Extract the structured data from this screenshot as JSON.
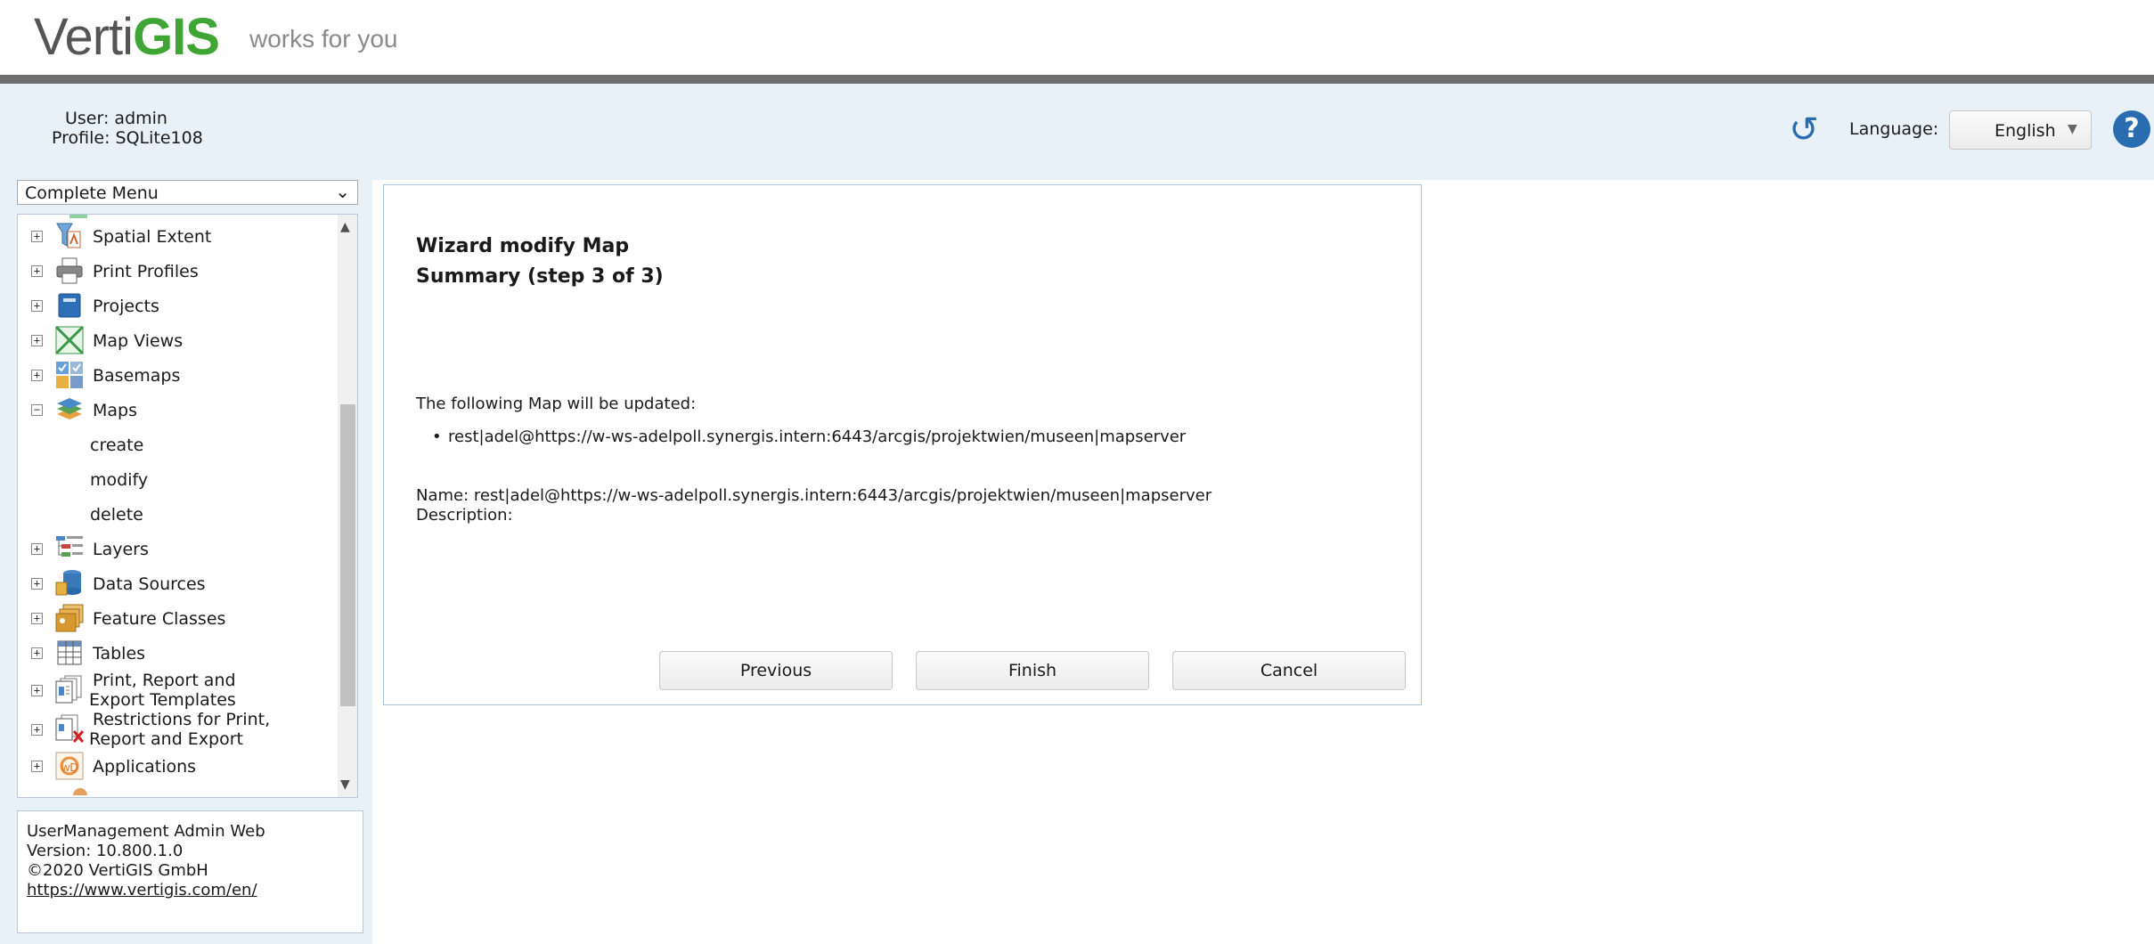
{
  "brand": {
    "logo_part1": "Verti",
    "logo_part2": "GIS",
    "tagline": "works for you"
  },
  "user": {
    "user_label": "User:",
    "user_value": "admin",
    "profile_label": "Profile:",
    "profile_value": "SQLite108"
  },
  "header": {
    "language_label": "Language:",
    "language_value": "English",
    "help_label": "?"
  },
  "menu": {
    "selected": "Complete Menu",
    "items": [
      {
        "label": "Spatial Extent",
        "icon": "spatial-extent-icon",
        "expanded": false
      },
      {
        "label": "Print Profiles",
        "icon": "printer-icon",
        "expanded": false
      },
      {
        "label": "Projects",
        "icon": "project-icon",
        "expanded": false
      },
      {
        "label": "Map Views",
        "icon": "map-view-icon",
        "expanded": false
      },
      {
        "label": "Basemaps",
        "icon": "basemap-icon",
        "expanded": false
      },
      {
        "label": "Maps",
        "icon": "map-layers-icon",
        "expanded": true
      },
      {
        "label": "create"
      },
      {
        "label": "modify"
      },
      {
        "label": "delete"
      },
      {
        "label": "Layers",
        "icon": "layer-icon",
        "expanded": false
      },
      {
        "label": "Data Sources",
        "icon": "database-icon",
        "expanded": false
      },
      {
        "label": "Feature Classes",
        "icon": "feature-class-icon",
        "expanded": false
      },
      {
        "label": "Tables",
        "icon": "table-icon",
        "expanded": false
      },
      {
        "label_line1": "Print, Report and",
        "label_line2": "Export Templates",
        "icon": "template-icon",
        "expanded": false
      },
      {
        "label_line1": "Restrictions for Print,",
        "label_line2": "Report and Export",
        "icon": "restriction-icon",
        "expanded": false
      },
      {
        "label": "Applications",
        "icon": "application-icon",
        "expanded": false
      }
    ]
  },
  "about": {
    "line1": "UserManagement Admin Web",
    "line2": "Version: 10.800.1.0",
    "line3": "©2020 VertiGIS GmbH",
    "link": "https://www.vertigis.com/en/"
  },
  "wizard": {
    "title": "Wizard modify Map",
    "subtitle": "Summary (step 3 of 3)",
    "intro": "The following Map will be updated:",
    "map_item": "rest|adel@https://w-ws-adelpoll.synergis.intern:6443/arcgis/projektwien/museen|mapserver",
    "name_label": "Name:",
    "name_value": "rest|adel@https://w-ws-adelpoll.synergis.intern:6443/arcgis/projektwien/museen|mapserver",
    "description_label": "Description:",
    "buttons": {
      "previous": "Previous",
      "finish": "Finish",
      "cancel": "Cancel"
    }
  },
  "colors": {
    "accent_blue": "#2a6cb0",
    "brand_green": "#3fa535",
    "panel_bg": "#e8f0f8"
  }
}
